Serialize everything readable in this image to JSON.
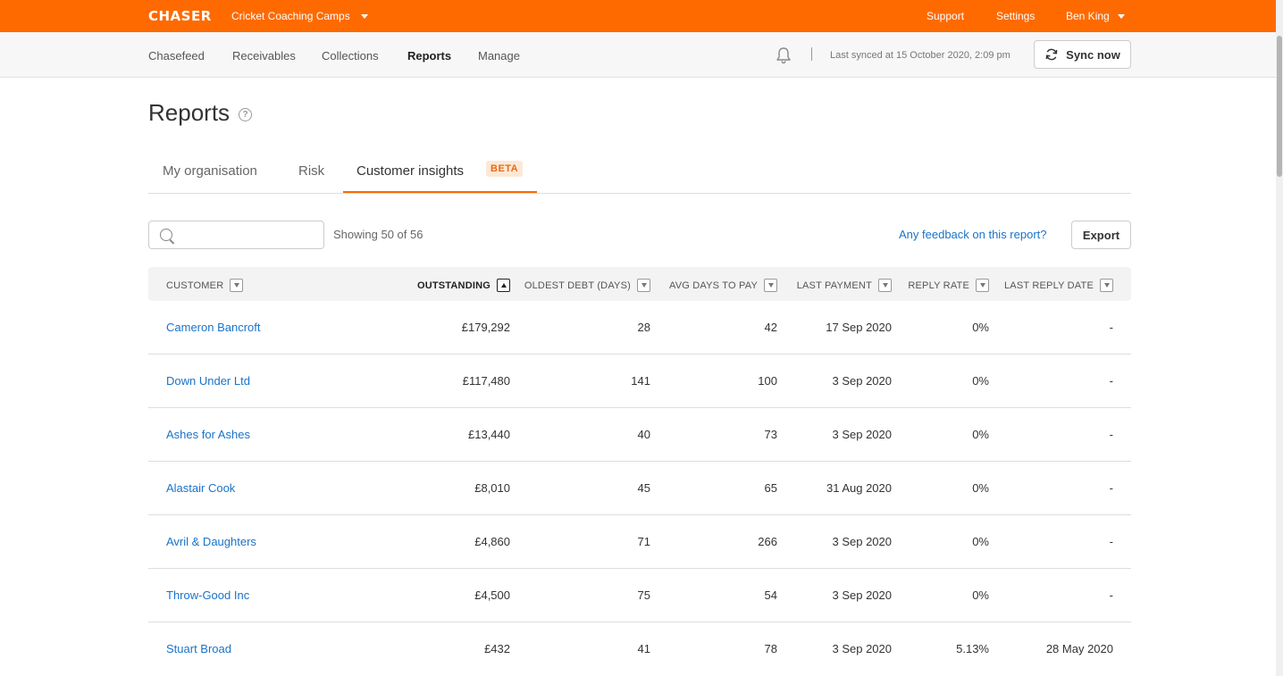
{
  "topbar": {
    "logo": "CHASER",
    "organisation": "Cricket Coaching Camps",
    "support": "Support",
    "settings": "Settings",
    "user": "Ben King"
  },
  "nav": {
    "items": [
      "Chasefeed",
      "Receivables",
      "Collections",
      "Reports",
      "Manage"
    ],
    "active": "Reports",
    "last_synced": "Last synced at 15 October 2020, 2:09 pm",
    "sync_button": "Sync now"
  },
  "page": {
    "title": "Reports",
    "help_icon": "?"
  },
  "tabs": {
    "items": [
      "My organisation",
      "Risk",
      "Customer insights"
    ],
    "active": "Customer insights",
    "beta_badge": "BETA"
  },
  "toolbar": {
    "search_value": "",
    "showing": "Showing 50 of 56",
    "feedback_link": "Any feedback on this report?",
    "export_button": "Export"
  },
  "table": {
    "columns": [
      "CUSTOMER",
      "OUTSTANDING",
      "OLDEST DEBT (DAYS)",
      "AVG DAYS TO PAY",
      "LAST PAYMENT",
      "REPLY RATE",
      "LAST REPLY DATE"
    ],
    "sorted_column": "OUTSTANDING",
    "rows": [
      {
        "customer": "Cameron Bancroft",
        "outstanding": "£179,292",
        "oldest_debt": "28",
        "avg_days": "42",
        "last_payment": "17 Sep 2020",
        "reply_rate": "0%",
        "last_reply": "-"
      },
      {
        "customer": "Down Under Ltd",
        "outstanding": "£117,480",
        "oldest_debt": "141",
        "avg_days": "100",
        "last_payment": "3 Sep 2020",
        "reply_rate": "0%",
        "last_reply": "-"
      },
      {
        "customer": "Ashes for Ashes",
        "outstanding": "£13,440",
        "oldest_debt": "40",
        "avg_days": "73",
        "last_payment": "3 Sep 2020",
        "reply_rate": "0%",
        "last_reply": "-"
      },
      {
        "customer": "Alastair Cook",
        "outstanding": "£8,010",
        "oldest_debt": "45",
        "avg_days": "65",
        "last_payment": "31 Aug 2020",
        "reply_rate": "0%",
        "last_reply": "-"
      },
      {
        "customer": "Avril & Daughters",
        "outstanding": "£4,860",
        "oldest_debt": "71",
        "avg_days": "266",
        "last_payment": "3 Sep 2020",
        "reply_rate": "0%",
        "last_reply": "-"
      },
      {
        "customer": "Throw-Good Inc",
        "outstanding": "£4,500",
        "oldest_debt": "75",
        "avg_days": "54",
        "last_payment": "3 Sep 2020",
        "reply_rate": "0%",
        "last_reply": "-"
      },
      {
        "customer": "Stuart Broad",
        "outstanding": "£432",
        "oldest_debt": "41",
        "avg_days": "78",
        "last_payment": "3 Sep 2020",
        "reply_rate": "5.13%",
        "last_reply": "28 May 2020"
      }
    ]
  },
  "colors": {
    "brand_orange": "#fe6a00",
    "link_blue": "#1a73c9",
    "beta_bg": "#fde8d6",
    "beta_text": "#e86a14"
  }
}
